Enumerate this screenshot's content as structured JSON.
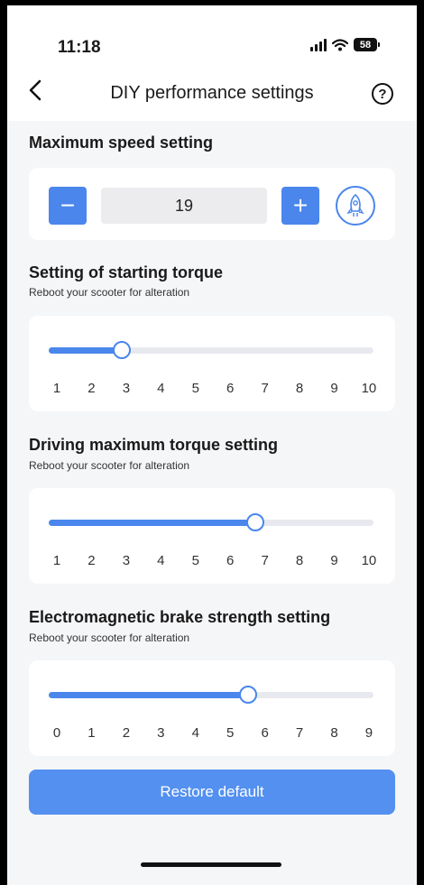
{
  "status_bar": {
    "time": "11:18",
    "battery": "58"
  },
  "nav": {
    "back_icon": "chevron-left-icon",
    "title": "DIY performance settings",
    "help_icon": "question-circle-icon"
  },
  "max_speed": {
    "title": "Maximum speed setting",
    "value": "19",
    "minus_label": "−",
    "plus_label": "+",
    "mode_icon": "rocket-icon"
  },
  "starting_torque": {
    "title": "Setting of starting torque",
    "subtitle": "Reboot your scooter for alteration",
    "ticks": [
      "1",
      "2",
      "3",
      "4",
      "5",
      "6",
      "7",
      "8",
      "9",
      "10"
    ],
    "level": 3
  },
  "driving_torque": {
    "title": "Driving maximum torque setting",
    "subtitle": "Reboot your scooter for alteration",
    "ticks": [
      "1",
      "2",
      "3",
      "4",
      "5",
      "6",
      "7",
      "8",
      "9",
      "10"
    ],
    "level": 6.7
  },
  "brake_strength": {
    "title": "Electromagnetic brake strength setting",
    "subtitle": "Reboot your scooter for alteration",
    "ticks": [
      "0",
      "1",
      "2",
      "3",
      "4",
      "5",
      "6",
      "7",
      "8",
      "9"
    ],
    "level": 5.5
  },
  "restore_button": {
    "label": "Restore default"
  },
  "colors": {
    "accent": "#4a86ec",
    "background": "#f5f6f8",
    "track": "#e8e9ee"
  }
}
